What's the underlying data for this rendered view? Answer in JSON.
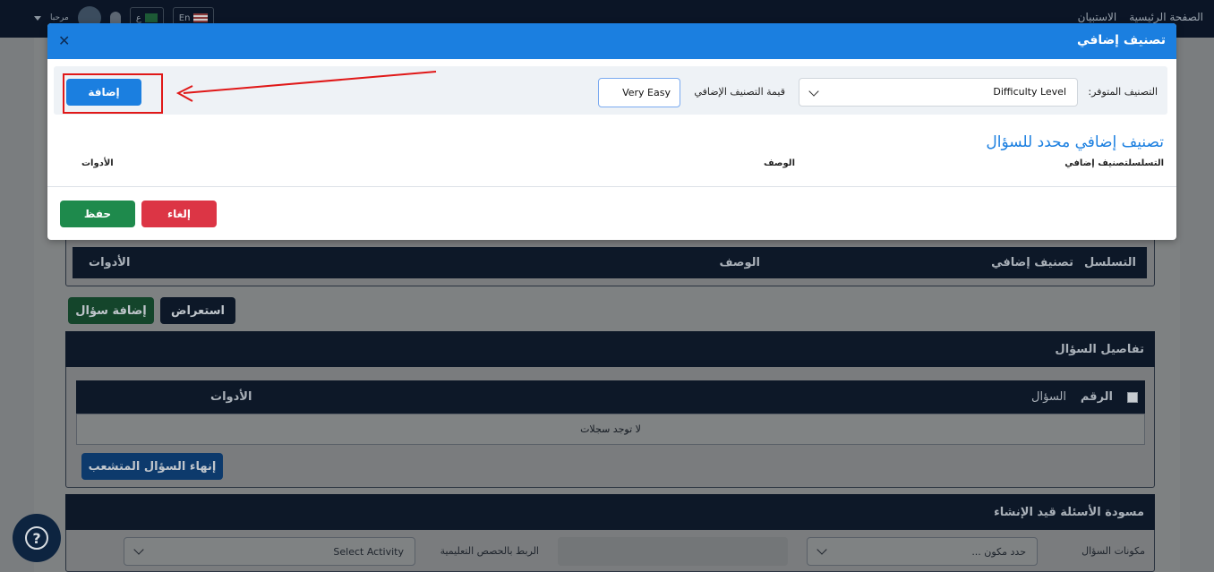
{
  "topbar": {
    "nav_home": "الصفحة الرئيسية",
    "nav_survey": "الاستبيان",
    "greeting": "مرحبا",
    "lang_ar": "ع",
    "lang_en": "En"
  },
  "background": {
    "table_headers": {
      "serial": "التسلسل",
      "extra_class": "تصنيف إضافي",
      "description": "الوصف",
      "tools": "الأدوات"
    },
    "preview_button": "استعراض",
    "add_question_button": "إضافة سؤال",
    "question_details_title": "تفاصيل السؤال",
    "details_headers": {
      "number": "الرقم",
      "question": "السؤال",
      "tools": "الأدوات"
    },
    "no_records": "لا توجد سجلات",
    "end_branched_button": "إنهاء السؤال المتشعب",
    "drafts_title": "مسودة الأسئلة قيد الإنشاء",
    "question_components_label": "مكونات السؤال",
    "component_select_placeholder": "حدد مكون ...",
    "link_label": "الربط بالحصص التعليمية",
    "activity_select": "Select Activity"
  },
  "modal": {
    "title": "تصنيف إضافي",
    "available_class_label": "التصنيف المتوفر:",
    "available_class_value": "Difficulty Level",
    "extra_value_label": "قيمة التصنيف الإضافي",
    "extra_value_input": "Very Easy",
    "add_button": "إضافة",
    "section_title": "تصنيف إضافي محدد للسؤال",
    "headers": {
      "serial_extra": "التسلسلتصنيف إضافي",
      "description": "الوصف",
      "tools": "الأدوات"
    },
    "cancel_button": "إلغاء",
    "save_button": "حفظ"
  },
  "colors": {
    "primary": "#1b7fe0",
    "danger": "#dc3545",
    "success": "#1e8a4c",
    "highlight": "#e01818"
  }
}
